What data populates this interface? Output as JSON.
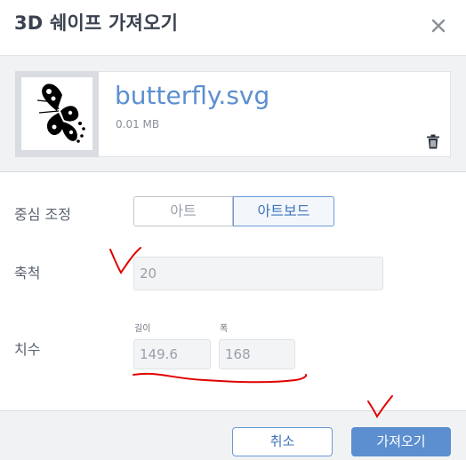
{
  "dialog": {
    "title": "3D 쉐이프 가져오기",
    "close_icon": "close-icon"
  },
  "file": {
    "name": "butterfly.svg",
    "size": "0.01 MB",
    "thumbnail_icon": "butterfly-thumbnail",
    "delete_icon": "trash-icon"
  },
  "center": {
    "label": "중심 조정",
    "options": [
      {
        "label": "아트",
        "selected": false
      },
      {
        "label": "아트보드",
        "selected": true
      }
    ]
  },
  "scale": {
    "label": "축척",
    "value": "20"
  },
  "dimensions": {
    "label": "치수",
    "length_label": "길이",
    "length_value": "149.6",
    "width_label": "폭",
    "width_value": "168"
  },
  "footer": {
    "cancel_label": "취소",
    "import_label": "가져오기"
  },
  "colors": {
    "accent": "#5b8fd0",
    "annotation": "#e00000"
  }
}
